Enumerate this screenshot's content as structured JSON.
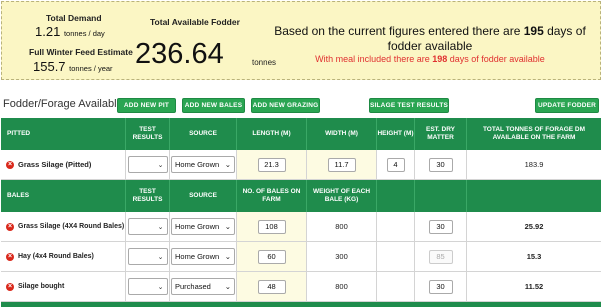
{
  "summary": {
    "total_demand_label": "Total Demand",
    "total_demand_value": "1.21",
    "total_demand_unit": "tonnes / day",
    "winter_feed_label": "Full Winter Feed Estimate",
    "winter_feed_value": "155.7",
    "winter_feed_unit": "tonnes / year",
    "available_label": "Total Available Fodder",
    "available_value": "236.64",
    "available_unit": "tonnes",
    "message_pre": "Based on the current figures entered there are ",
    "message_days": "195",
    "message_post": " days of fodder available",
    "meal_pre": "With meal included there are ",
    "meal_days": "198",
    "meal_post": " days of fodder available"
  },
  "toolbar": {
    "section_title": "Fodder/Forage Available",
    "add_pit": "ADD NEW PIT",
    "add_bales": "ADD NEW BALES",
    "add_grazing": "ADD NEW GRAZING",
    "silage_results": "SILAGE TEST RESULTS",
    "update": "UPDATE FODDER"
  },
  "pitted": {
    "headers": {
      "type": "PITTED",
      "test": "TEST RESULTS",
      "source": "SOURCE",
      "length": "LENGTH (M)",
      "width": "WIDTH (M)",
      "height": "HEIGHT (M)",
      "dry": "EST. DRY MATTER",
      "total": "TOTAL TONNES OF FORAGE DM AVAILABLE ON THE FARM"
    },
    "rows": [
      {
        "name": "Grass Silage (Pitted)",
        "source": "Home Grown",
        "length": "21.3",
        "width": "11.7",
        "height": "4",
        "dry": "30",
        "total": "183.9"
      }
    ]
  },
  "bales": {
    "headers": {
      "type": "BALES",
      "test": "TEST RESULTS",
      "source": "SOURCE",
      "count": "NO. OF BALES ON FARM",
      "weight": "WEIGHT OF EACH BALE (KG)"
    },
    "rows": [
      {
        "name": "Grass Silage (4X4 Round Bales)",
        "source": "Home Grown",
        "count": "108",
        "weight": "800",
        "dry": "30",
        "total": "25.92"
      },
      {
        "name": "Hay (4x4 Round Bales)",
        "source": "Home Grown",
        "count": "60",
        "weight": "300",
        "dry": "85",
        "total": "15.3"
      },
      {
        "name": "Silage bought",
        "source": "Purchased",
        "count": "48",
        "weight": "800",
        "dry": "30",
        "total": "11.52"
      }
    ]
  },
  "icons": {
    "remove": "remove-x-icon",
    "dropdown": "chevron-down-icon"
  },
  "colors": {
    "header_green": "#1f8c4c",
    "button_green": "#2aa552",
    "summary_bg": "#fbf6c4",
    "warning_red": "#e03030"
  }
}
